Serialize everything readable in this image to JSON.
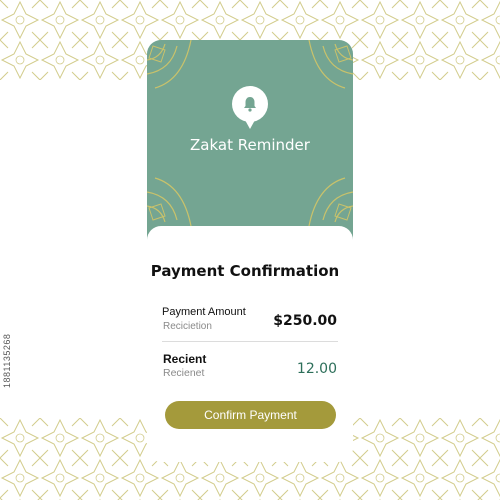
{
  "colors": {
    "header_green": "#74a592",
    "accent_gold": "#a49a3b",
    "pattern_gold": "#d2cc8c",
    "recipient_value_green": "#2d6f5a"
  },
  "header": {
    "icon": "bell-icon",
    "title": "Zakat Reminder"
  },
  "confirmation": {
    "title": "Payment Confirmation",
    "amount_row": {
      "label": "Payment Amount",
      "sublabel": "Recicietion",
      "value": "$250.00"
    },
    "recipient_row": {
      "label": "Recient",
      "sublabel": "Recienet",
      "value": "12.00"
    },
    "button_label": "Confirm Payment"
  },
  "watermark": {
    "id_text": "1881135268"
  }
}
